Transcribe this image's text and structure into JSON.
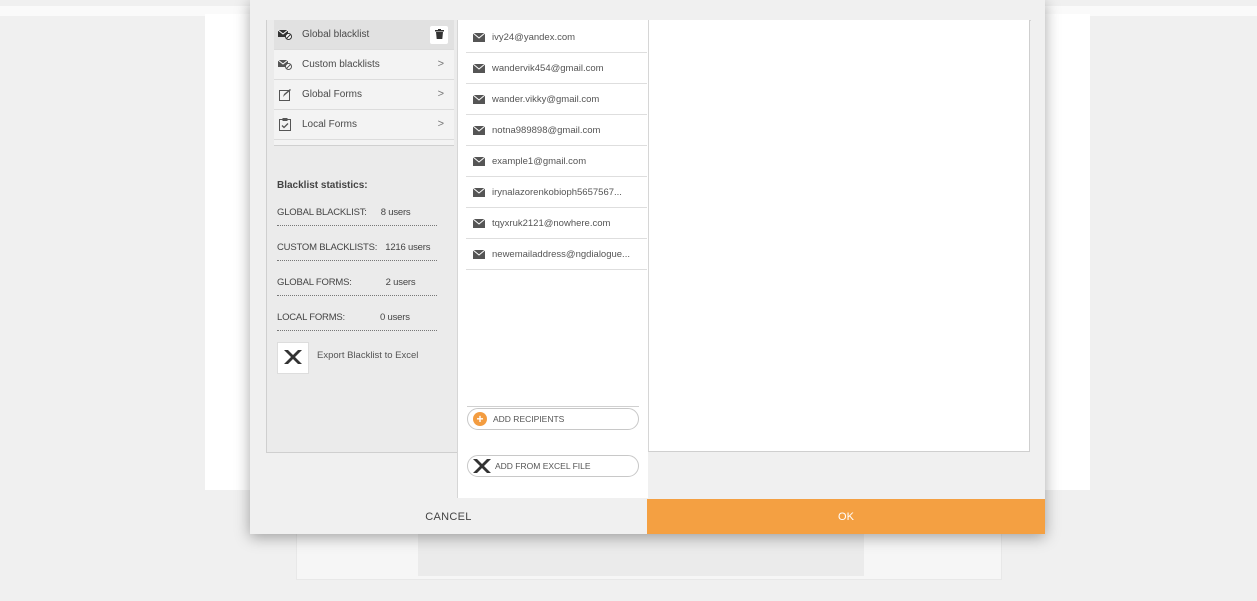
{
  "menu": {
    "items": [
      {
        "label": "Global blacklist",
        "icon": "blacklist-icon",
        "active": true
      },
      {
        "label": "Custom blacklists",
        "icon": "blacklist-icon"
      },
      {
        "label": "Global Forms",
        "icon": "edit-form-icon"
      },
      {
        "label": "Local Forms",
        "icon": "clipboard-check-icon"
      }
    ],
    "chevron": ">"
  },
  "stats": {
    "title": "Blacklist statistics:",
    "rows": [
      {
        "key": "GLOBAL BLACKLIST:",
        "value": "8 users"
      },
      {
        "key": "CUSTOM BLACKLISTS:",
        "value": "1216 users"
      },
      {
        "key": "GLOBAL FORMS:",
        "value": "2 users"
      },
      {
        "key": "LOCAL FORMS:",
        "value": "0 users"
      }
    ]
  },
  "export": {
    "label": "Export Blacklist to Excel",
    "icon": "excel-icon"
  },
  "emails": [
    "ivy24@yandex.com",
    "wandervik454@gmail.com",
    "wander.vikky@gmail.com",
    "notna989898@gmail.com",
    "example1@gmail.com",
    "irynalazorenkobioph5657567...",
    "tqyxruk2121@nowhere.com",
    "newemailaddress@ngdialogue..."
  ],
  "actions": {
    "add_recipients": "ADD RECIPIENTS",
    "add_from_excel": "ADD FROM EXCEL FILE"
  },
  "footer": {
    "cancel": "CANCEL",
    "ok": "OK"
  },
  "colors": {
    "accent": "#f4a042",
    "panel": "#ebebeb"
  }
}
